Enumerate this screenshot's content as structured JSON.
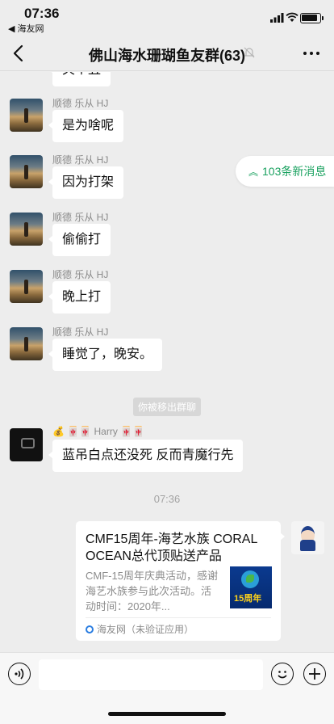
{
  "status_bar": {
    "time": "07:36",
    "back_app": "◀ 海友网"
  },
  "nav": {
    "title": "佛山海水珊瑚鱼友群(63)"
  },
  "new_messages": {
    "label": "103条新消息"
  },
  "messages": [
    {
      "sender": "",
      "text": "关个丑"
    },
    {
      "sender": "顺德 乐从 HJ",
      "text": "是为啥呢"
    },
    {
      "sender": "顺德 乐从 HJ",
      "text": "因为打架"
    },
    {
      "sender": "顺德 乐从 HJ",
      "text": "偷偷打"
    },
    {
      "sender": "顺德 乐从 HJ",
      "text": "晚上打"
    },
    {
      "sender": "顺德 乐从 HJ",
      "text": "睡觉了，晚安。"
    },
    {
      "sender": "💰 🀄🀄 Harry 🀄🀄",
      "text": "蓝吊白点还没死  反而青魔行先"
    }
  ],
  "system_notice": "你被移出群聊",
  "timestamp": "07:36",
  "link_card": {
    "title": "CMF15周年-海艺水族 CORAL OCEAN总代顶贴送产品",
    "description": "CMF-15周年庆典活动，感谢海艺水族参与此次活动。活动时间：2020年...",
    "thumb_text": "15周年",
    "source": "海友网（未验证应用）"
  },
  "input": {
    "placeholder": ""
  }
}
